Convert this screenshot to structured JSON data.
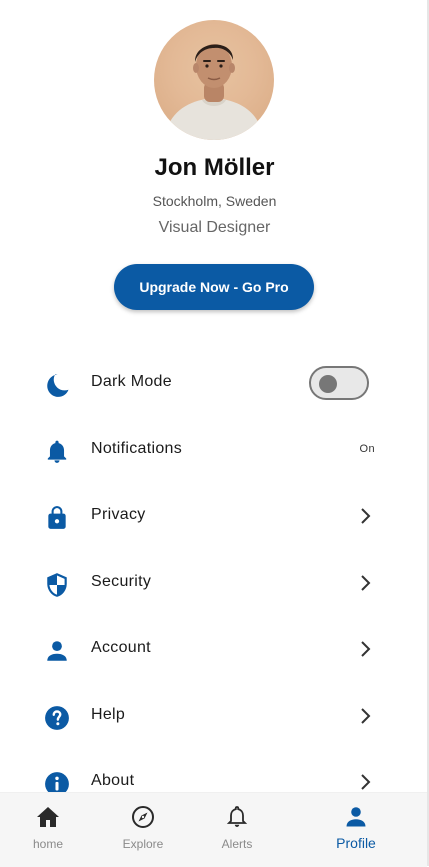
{
  "profile": {
    "name": "Jon Möller",
    "location": "Stockholm, Sweden",
    "role": "Visual Designer",
    "upgrade_label": "Upgrade Now - Go Pro"
  },
  "settings": {
    "items": [
      {
        "label": "Dark Mode",
        "icon": "moon-icon",
        "control": "toggle",
        "toggle_on": false
      },
      {
        "label": "Notifications",
        "icon": "bell-icon",
        "control": "status",
        "status": "On"
      },
      {
        "label": "Privacy",
        "icon": "lock-icon",
        "control": "chevron"
      },
      {
        "label": "Security",
        "icon": "shield-icon",
        "control": "chevron"
      },
      {
        "label": "Account",
        "icon": "person-icon",
        "control": "chevron"
      },
      {
        "label": "Help",
        "icon": "help-icon",
        "control": "chevron"
      },
      {
        "label": "About",
        "icon": "info-icon",
        "control": "chevron"
      }
    ]
  },
  "nav": {
    "items": [
      {
        "label": "home",
        "icon": "home-icon",
        "active": false
      },
      {
        "label": "Explore",
        "icon": "compass-icon",
        "active": false
      },
      {
        "label": "Alerts",
        "icon": "bell-icon",
        "active": false
      },
      {
        "label": "Profile",
        "icon": "person-icon",
        "active": true
      }
    ]
  },
  "colors": {
    "accent": "#0b5aa4",
    "inactive_nav": "#8a8a8a",
    "background": "#ffffff"
  }
}
